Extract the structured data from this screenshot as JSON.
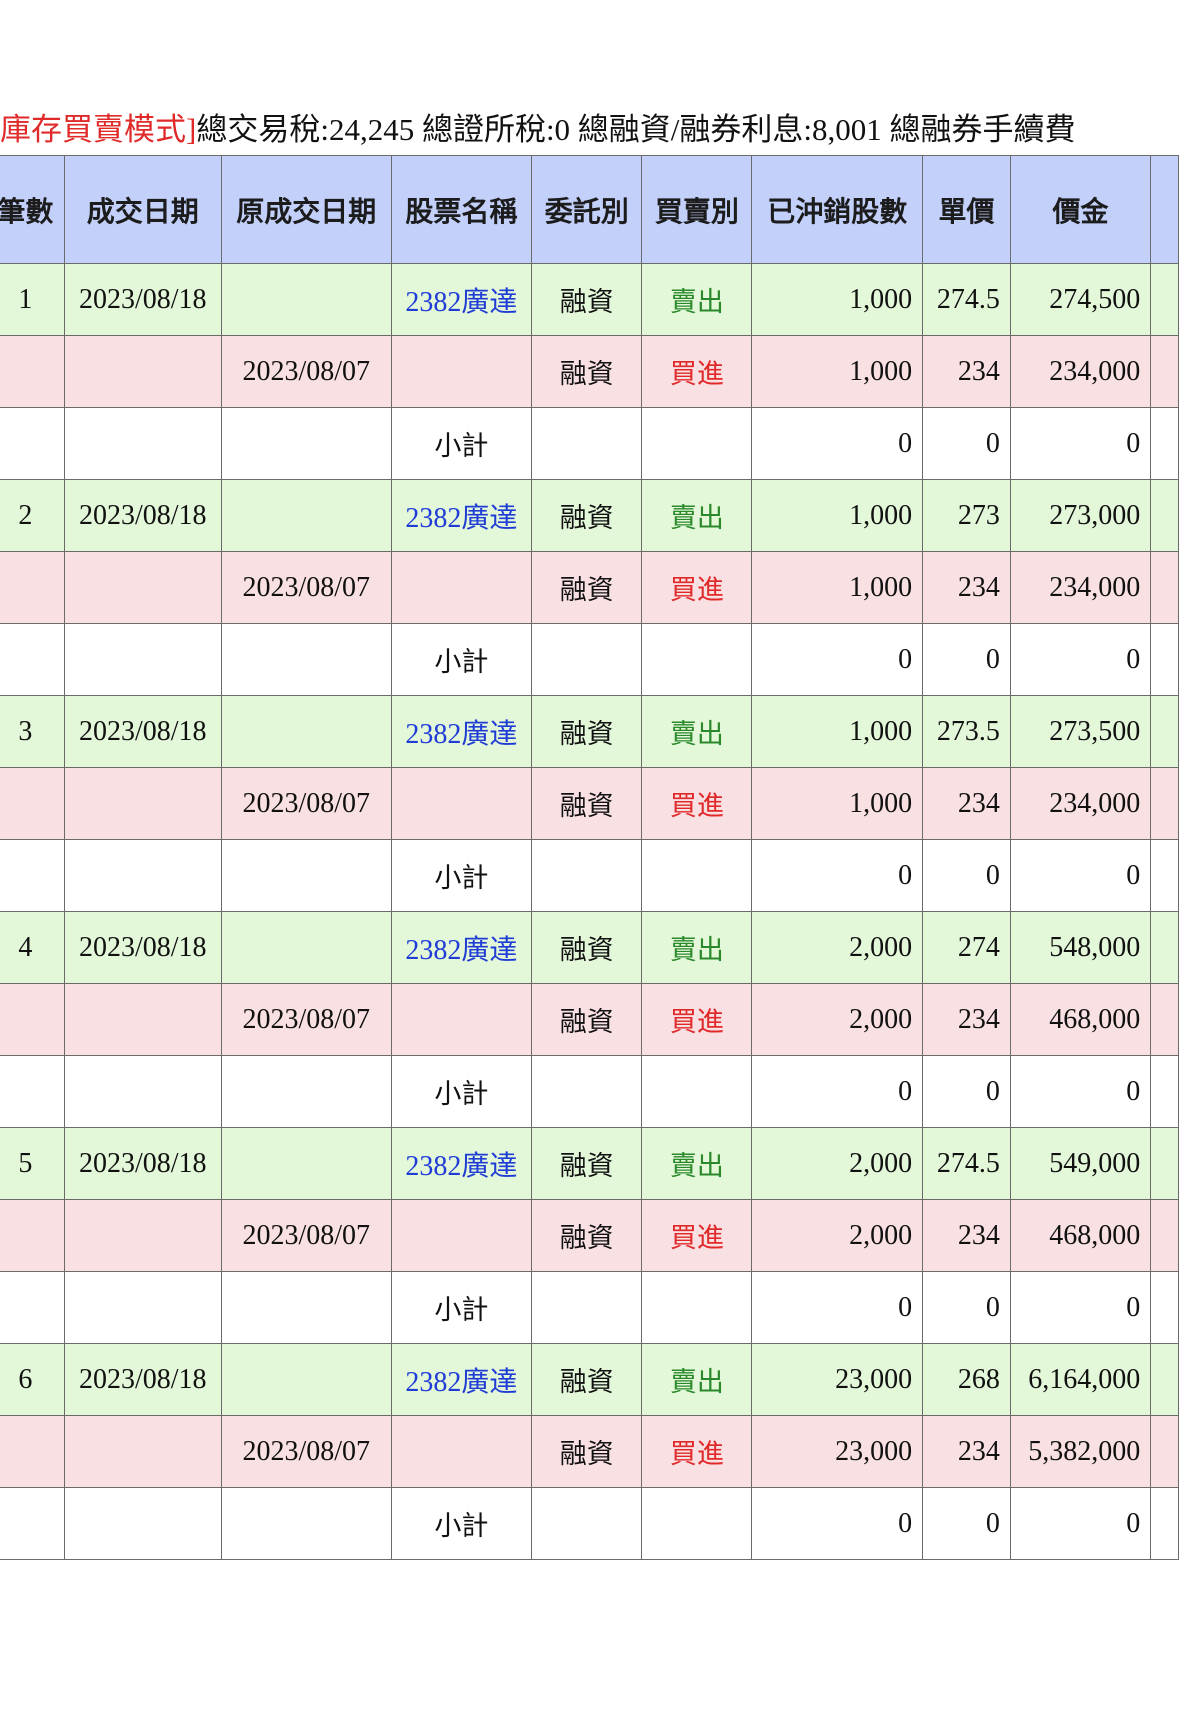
{
  "summary": {
    "mode_label": "庫存買賣模式]",
    "totals_text": "總交易稅:24,245 總證所稅:0 總融資/融券利息:8,001 總融券手續費"
  },
  "colors": {
    "header_bg": "#c2d0fa",
    "sell_row_bg": "#e3f7d9",
    "buy_row_bg": "#f9e0e2",
    "sell_text": "#2a8a2a",
    "buy_text": "#e02a2a",
    "stock_link": "#1f3cd6"
  },
  "table": {
    "headers": [
      "筆數",
      "成交日期",
      "原成交日期",
      "股票名稱",
      "委託別",
      "買賣別",
      "已沖銷股數",
      "單價",
      "價金"
    ],
    "groups": [
      {
        "sell": {
          "no": "1",
          "date": "2023/08/18",
          "stock": "2382廣達",
          "order_type": "融資",
          "side": "賣出",
          "shares": "1,000",
          "price": "274.5",
          "amount": "274,500"
        },
        "buy": {
          "orig_date": "2023/08/07",
          "order_type": "融資",
          "side": "買進",
          "shares": "1,000",
          "price": "234",
          "amount": "234,000"
        },
        "subtotal": {
          "label": "小計",
          "shares": "0",
          "price": "0",
          "amount": "0"
        }
      },
      {
        "sell": {
          "no": "2",
          "date": "2023/08/18",
          "stock": "2382廣達",
          "order_type": "融資",
          "side": "賣出",
          "shares": "1,000",
          "price": "273",
          "amount": "273,000"
        },
        "buy": {
          "orig_date": "2023/08/07",
          "order_type": "融資",
          "side": "買進",
          "shares": "1,000",
          "price": "234",
          "amount": "234,000"
        },
        "subtotal": {
          "label": "小計",
          "shares": "0",
          "price": "0",
          "amount": "0"
        }
      },
      {
        "sell": {
          "no": "3",
          "date": "2023/08/18",
          "stock": "2382廣達",
          "order_type": "融資",
          "side": "賣出",
          "shares": "1,000",
          "price": "273.5",
          "amount": "273,500"
        },
        "buy": {
          "orig_date": "2023/08/07",
          "order_type": "融資",
          "side": "買進",
          "shares": "1,000",
          "price": "234",
          "amount": "234,000"
        },
        "subtotal": {
          "label": "小計",
          "shares": "0",
          "price": "0",
          "amount": "0"
        }
      },
      {
        "sell": {
          "no": "4",
          "date": "2023/08/18",
          "stock": "2382廣達",
          "order_type": "融資",
          "side": "賣出",
          "shares": "2,000",
          "price": "274",
          "amount": "548,000"
        },
        "buy": {
          "orig_date": "2023/08/07",
          "order_type": "融資",
          "side": "買進",
          "shares": "2,000",
          "price": "234",
          "amount": "468,000"
        },
        "subtotal": {
          "label": "小計",
          "shares": "0",
          "price": "0",
          "amount": "0"
        }
      },
      {
        "sell": {
          "no": "5",
          "date": "2023/08/18",
          "stock": "2382廣達",
          "order_type": "融資",
          "side": "賣出",
          "shares": "2,000",
          "price": "274.5",
          "amount": "549,000"
        },
        "buy": {
          "orig_date": "2023/08/07",
          "order_type": "融資",
          "side": "買進",
          "shares": "2,000",
          "price": "234",
          "amount": "468,000"
        },
        "subtotal": {
          "label": "小計",
          "shares": "0",
          "price": "0",
          "amount": "0"
        }
      },
      {
        "sell": {
          "no": "6",
          "date": "2023/08/18",
          "stock": "2382廣達",
          "order_type": "融資",
          "side": "賣出",
          "shares": "23,000",
          "price": "268",
          "amount": "6,164,000"
        },
        "buy": {
          "orig_date": "2023/08/07",
          "order_type": "融資",
          "side": "買進",
          "shares": "23,000",
          "price": "234",
          "amount": "5,382,000"
        },
        "subtotal": {
          "label": "小計",
          "shares": "0",
          "price": "0",
          "amount": "0"
        }
      }
    ]
  }
}
